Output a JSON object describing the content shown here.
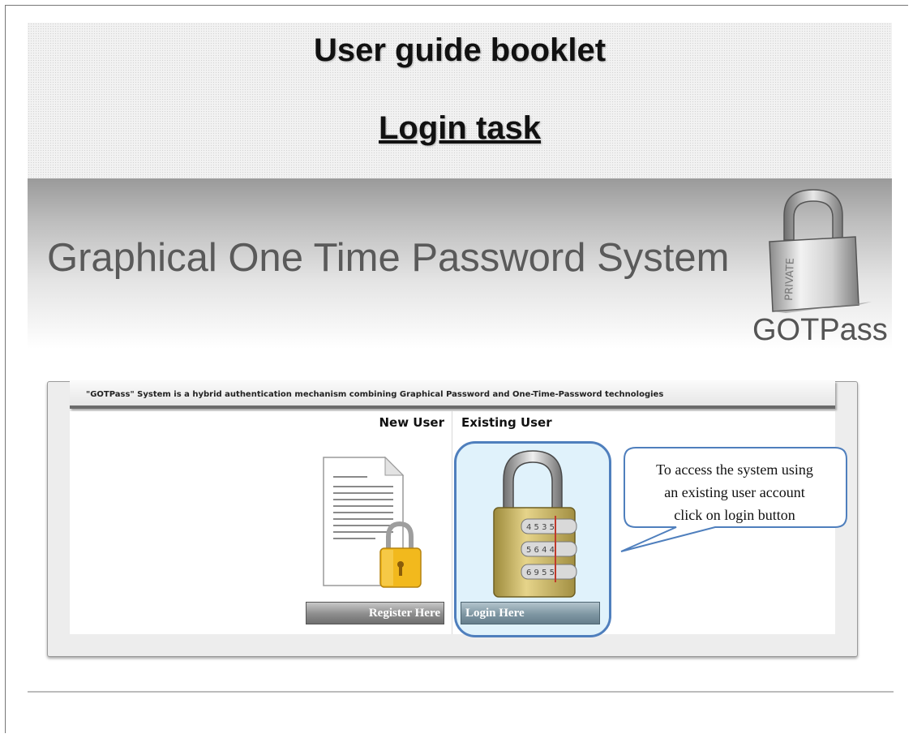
{
  "booklet": {
    "title": "User guide booklet",
    "subtitle": "Login task"
  },
  "banner": {
    "system_title": "Graphical One Time Password System",
    "brand": "GOTPass",
    "lock_label": "PRIVATE",
    "lock_icon": "padlock-icon"
  },
  "panel": {
    "info_text": "\"GOTPass\" System is a hybrid authentication mechanism combining Graphical Password and One-Time-Password technologies",
    "new_user": {
      "heading": "New User",
      "icon": "document-lock-icon",
      "button_label": "Register Here"
    },
    "existing_user": {
      "heading": "Existing User",
      "icon": "combination-lock-icon",
      "button_label": "Login Here"
    }
  },
  "callout": {
    "lines": [
      "To access the system using",
      "an existing  user account",
      "click on login  button"
    ],
    "border_color": "#4f7fbd"
  },
  "colors": {
    "highlight_fill": "#e0f2fb",
    "highlight_border": "#4f7fbd"
  }
}
